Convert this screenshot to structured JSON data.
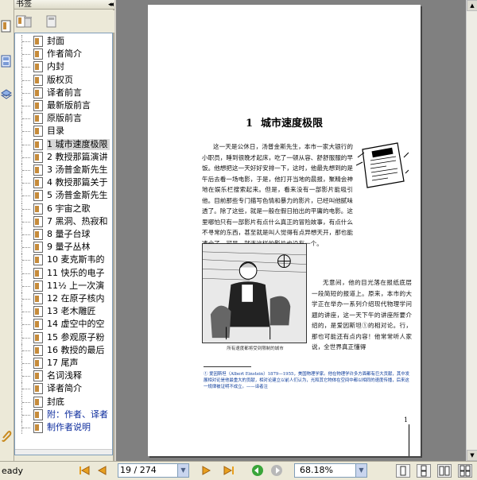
{
  "bookmarks_panel": {
    "title": "书签",
    "collapse_glyph": "◂◂",
    "items": [
      {
        "label": "封面"
      },
      {
        "label": "作者简介"
      },
      {
        "label": "内封"
      },
      {
        "label": "版权页"
      },
      {
        "label": "译者前言"
      },
      {
        "label": "最新版前言"
      },
      {
        "label": "原版前言"
      },
      {
        "label": "目录"
      },
      {
        "label": "1   城市速度极限",
        "selected": true
      },
      {
        "label": "2   教授那篇演讲"
      },
      {
        "label": "3   汤普金斯先生"
      },
      {
        "label": "4   教授那篇关于"
      },
      {
        "label": "5   汤普金斯先生"
      },
      {
        "label": "6   宇宙之歌"
      },
      {
        "label": "7   黑洞、热寂和"
      },
      {
        "label": "8   量子台球"
      },
      {
        "label": "9   量子丛林"
      },
      {
        "label": "10   麦克斯韦的"
      },
      {
        "label": "11   快乐的电子"
      },
      {
        "label": "11½   上一次演"
      },
      {
        "label": "12   在原子核内"
      },
      {
        "label": "13   老木雕匠"
      },
      {
        "label": "14   虚空中的空"
      },
      {
        "label": "15   参观原子粉"
      },
      {
        "label": "16   教授的最后"
      },
      {
        "label": "17   尾声"
      },
      {
        "label": "名词浅释"
      },
      {
        "label": "译者简介"
      },
      {
        "label": "封底"
      },
      {
        "label": "附：作者、译者",
        "link": true
      },
      {
        "label": "制作者说明",
        "link": true
      }
    ]
  },
  "document": {
    "chapter_number": "1",
    "chapter_title": "城市速度极限",
    "paragraph1": "这一天是公休日，汤普金斯先生，本市一家大银行的小职员，睡到很晚才起床，吃了一顿从容、舒舒服服的早饭。他想把这一天好好安排一下，这时，他最先想到的是午后去看一场电影，于是，他打开当地的晨报，聚精会神地在娱乐栏搜索起来。但是，看来没有一部影片能吸引他。目前那些专门描写色情和暴力的影片，已经叫他腻味透了。除了这些，就是一般在假日拍出的平庸的电影。这里哪怕只有一部影片有点什么真正的冒险故事，有点什么不寻常的东西，甚至就是叫人觉得有点异想天开，那也能凑合了。可是，就连这样的影片也没有一个。",
    "paragraph2": "无意间，他的目光落在报纸底层一段简短的报道上。原来，本市的大学正在举办一系列介绍现代物理学问题的讲座，这一天下午的讲座所要介绍的，是爱因斯坦①的相对论。行，那也可能还有点内容！他常常听人家说，全世界真正懂得",
    "figure_caption": "所有速度都将受到限制的城市",
    "footnote": "① 爱因斯坦（Albert Einstein）1879—1955，美国物理学家。他在物理学许多方面都有巨大贡献，其中发展相对论是他最重大的贡献，相对论建立以前人们认为，光和其它物体在空间中都以相同的速度传播，后来这一规律被证明不成立。——译者注",
    "page_number": "1"
  },
  "statusbar": {
    "status_text": "eady",
    "page_display": "19 / 274",
    "zoom_display": "68.18%"
  }
}
